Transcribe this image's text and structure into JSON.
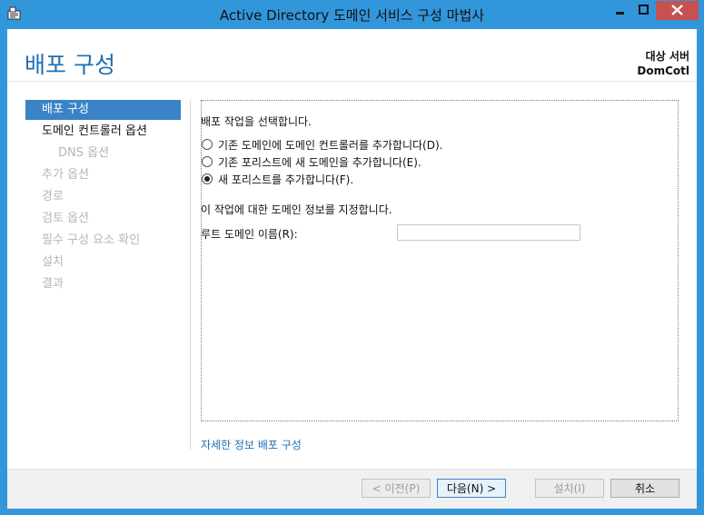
{
  "window": {
    "title": "Active Directory 도메인 서비스 구성 마법사"
  },
  "header": {
    "page_title": "배포 구성",
    "target_label": "대상 서버",
    "target_name": "DomCotl"
  },
  "nav": {
    "items": [
      {
        "label": "배포 구성",
        "state": "active"
      },
      {
        "label": "도메인 컨트롤러 옵션",
        "state": "enabled"
      },
      {
        "label": "DNS 옵션",
        "state": "disabled"
      },
      {
        "label": "추가 옵션",
        "state": "disabled"
      },
      {
        "label": "경로",
        "state": "disabled"
      },
      {
        "label": "검토 옵션",
        "state": "disabled"
      },
      {
        "label": "필수 구성 요소 확인",
        "state": "disabled"
      },
      {
        "label": "설치",
        "state": "disabled"
      },
      {
        "label": "결과",
        "state": "disabled"
      }
    ]
  },
  "main": {
    "instruction": "배포 작업을 선택합니다.",
    "options": [
      {
        "label": "기존 도메인에 도메인 컨트롤러를 추가합니다(D).",
        "checked": false
      },
      {
        "label": "기존 포리스트에 새 도메인을 추가합니다(E).",
        "checked": false
      },
      {
        "label": "새 포리스트를 추가합니다(F).",
        "checked": true
      }
    ],
    "specify_text": "이 작업에 대한 도메인 정보를 지정합니다.",
    "root_domain_label": "루트 도메인 이름(R):",
    "root_domain_value": "",
    "more_link": "자세한 정보 배포 구성"
  },
  "footer": {
    "prev_label": "< 이전(P)",
    "next_label": "다음(N) >",
    "install_label": "설치(I)",
    "cancel_label": "취소"
  }
}
